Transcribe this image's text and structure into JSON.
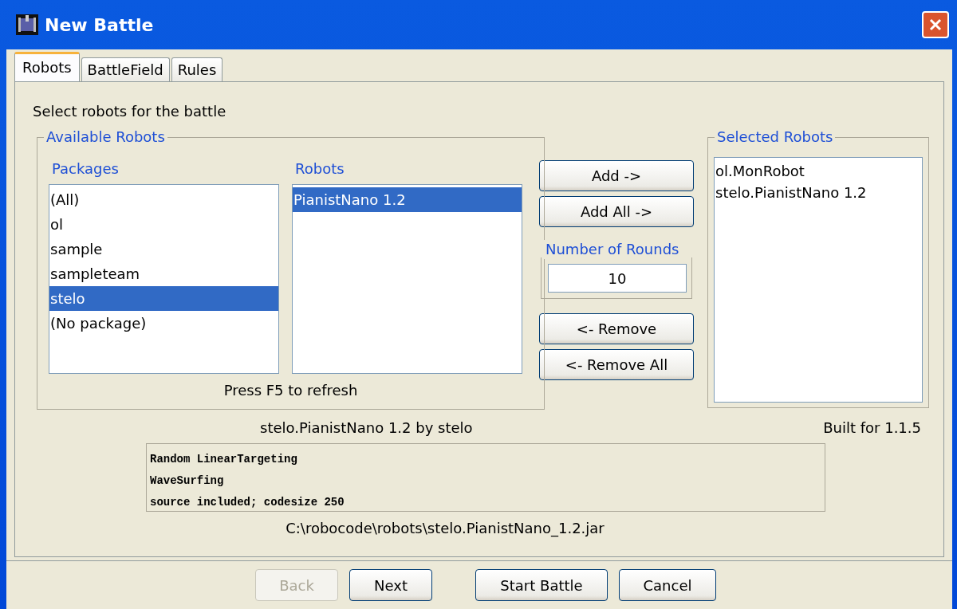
{
  "window": {
    "title": "New Battle"
  },
  "tabs": [
    {
      "label": "Robots",
      "selected": true
    },
    {
      "label": "BattleField",
      "selected": false
    },
    {
      "label": "Rules",
      "selected": false
    }
  ],
  "instruction": "Select robots for the battle",
  "available": {
    "title": "Available Robots",
    "packages": {
      "label": "Packages",
      "items": [
        {
          "label": "(All)",
          "selected": false
        },
        {
          "label": "ol",
          "selected": false
        },
        {
          "label": "sample",
          "selected": false
        },
        {
          "label": "sampleteam",
          "selected": false
        },
        {
          "label": "stelo",
          "selected": true
        },
        {
          "label": "(No package)",
          "selected": false
        }
      ]
    },
    "robots": {
      "label": "Robots",
      "items": [
        {
          "label": "PianistNano 1.2",
          "selected": true
        }
      ]
    },
    "hint": "Press F5 to refresh"
  },
  "add_buttons": [
    "Add ->",
    "Add All ->"
  ],
  "rounds": {
    "label": "Number of Rounds",
    "value": "10"
  },
  "remove_buttons": [
    "<- Remove",
    "<- Remove All"
  ],
  "selected_robots": {
    "title": "Selected Robots",
    "items": [
      "ol.MonRobot",
      "stelo.PianistNano 1.2"
    ]
  },
  "info": {
    "name": "stelo.PianistNano 1.2 by stelo",
    "built_for": "Built for 1.1.5",
    "description": [
      "Random LinearTargeting",
      "WaveSurfing",
      "source included; codesize 250"
    ],
    "path": "C:\\robocode\\robots\\stelo.PianistNano_1.2.jar"
  },
  "footer_buttons": [
    {
      "label": "Back",
      "disabled": true
    },
    {
      "label": "Next",
      "disabled": false
    },
    {
      "label": "Start Battle",
      "disabled": false
    },
    {
      "label": "Cancel",
      "disabled": false
    }
  ]
}
